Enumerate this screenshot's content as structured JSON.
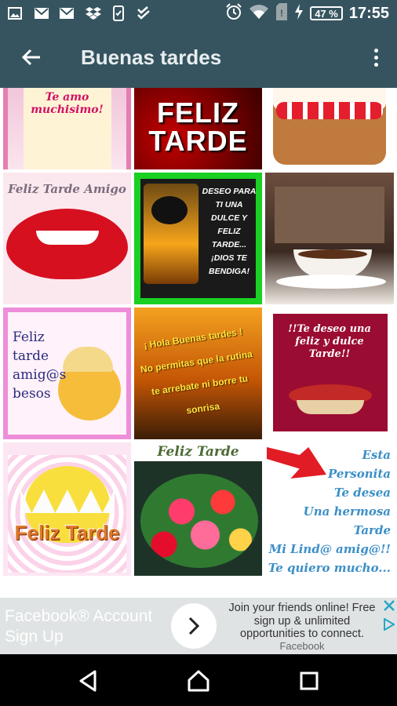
{
  "status_bar": {
    "battery": "47 %",
    "time": "17:55"
  },
  "app_bar": {
    "title": "Buenas tardes"
  },
  "grid": {
    "tiles": [
      {
        "text": "Te amo\nmuchisimo!"
      },
      {
        "text": "FELIZ\nTARDE"
      },
      {
        "text": ""
      },
      {
        "text": "Feliz Tarde Amigo"
      },
      {
        "text": "DESEO PARA\nTI UNA\nDULCE Y\nFELIZ\nTARDE...\n¡DIOS TE\nBENDIGA!"
      },
      {
        "text": ""
      },
      {
        "text": "Feliz\ntarde\namig@s\nbesos"
      },
      {
        "text": "¡ Hola Buenas tardes !\nNo permitas que la rutina\nte arrebate ni borre tu sonrisa"
      },
      {
        "text": "!!Te deseo una\nfeliz y dulce\nTarde!!"
      },
      {
        "text": "Feliz Tarde"
      },
      {
        "text": "Feliz Tarde"
      },
      {
        "text": "Esta\nPersonita\nTe desea\nUna hermosa Tarde\nMi Lind@ amig@!!\nTe quiero mucho..."
      }
    ]
  },
  "ad": {
    "headline": "Facebook® Account Sign Up",
    "body": "Join your friends online! Free sign up & unlimited opportunities to connect.",
    "advertiser": "Facebook"
  },
  "colors": {
    "app_bar": "#36545f",
    "nav_bar": "#000000",
    "ad_bg": "#dfe3e3"
  }
}
